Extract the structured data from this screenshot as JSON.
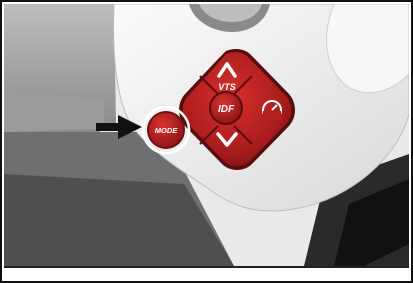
{
  "controls": {
    "vts_label": "VTS",
    "idf_label": "IDF",
    "mode_label": "MODE"
  },
  "colors": {
    "button_red": "#b3201f",
    "button_dark": "#6e0f10",
    "housing": "#f1f1f1",
    "background_gray": "#6f6f6f"
  },
  "icons": {
    "up": "chevron-up-icon",
    "down": "chevron-down-icon",
    "right": "speedometer-icon",
    "pointer": "arrow-pointer-icon"
  }
}
